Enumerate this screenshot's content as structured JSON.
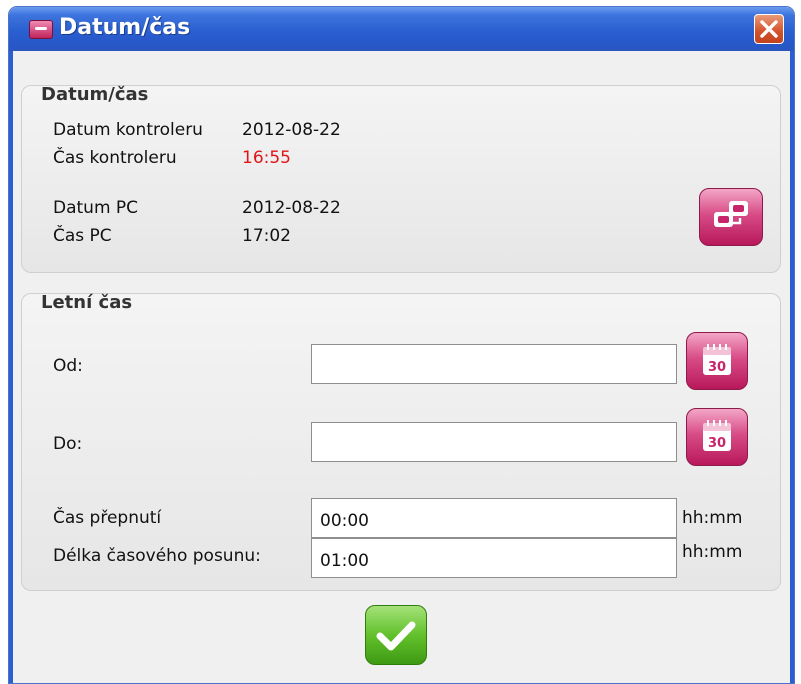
{
  "window": {
    "title": "Datum/čas",
    "colors": {
      "titlebar": "#2a5fd1",
      "accent_pink": "#c8246a",
      "ok_green": "#4fae1d",
      "red_value": "#e01515"
    }
  },
  "datetime_group": {
    "title": "Datum/čas",
    "controller_date_label": "Datum kontroleru",
    "controller_date_value": "2012-08-22",
    "controller_time_label": "Čas kontroleru",
    "controller_time_value": "16:55",
    "pc_date_label": "Datum PC",
    "pc_date_value": "2012-08-22",
    "pc_time_label": "Čas PC",
    "pc_time_value": "17:02",
    "sync_button_icon": "sync-time-icon"
  },
  "dst_group": {
    "title": "Letní čas",
    "from_label": "Od:",
    "from_value": "",
    "to_label": "Do:",
    "to_value": "",
    "calendar_icon_text": "30",
    "switch_time_label": "Čas přepnutí",
    "switch_time_value": "00:00",
    "switch_time_unit": "hh:mm",
    "offset_label": "Délka časového posunu:",
    "offset_value": "01:00",
    "offset_unit": "hh:mm"
  },
  "footer": {
    "ok_icon": "checkmark-icon"
  }
}
